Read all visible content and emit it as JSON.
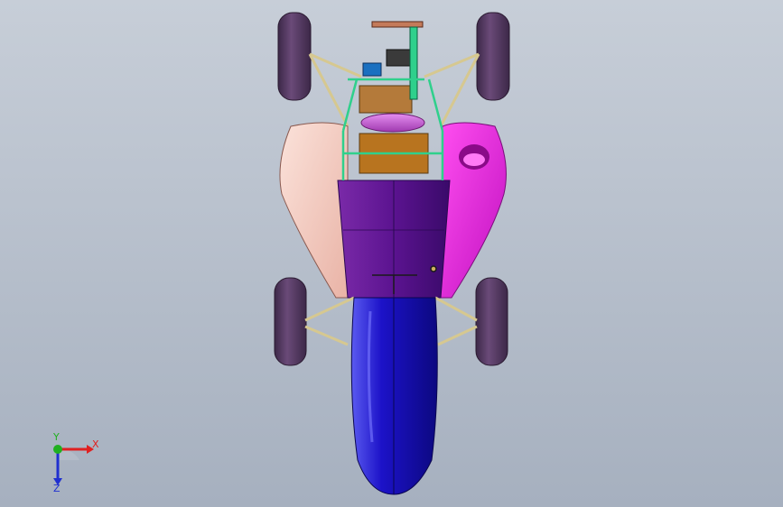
{
  "viewport": {
    "background_top": "#c7ced8",
    "background_bottom": "#a6b0bf"
  },
  "model": {
    "colors": {
      "tire": "#5a3f63",
      "nose": "#1c12c8",
      "pod_left": "#f6cfc4",
      "pod_right": "#e21ee0",
      "tub": "#5b1390",
      "frame_green": "#2fd08c",
      "engine": "#b47a3a",
      "tank": "#c45ad0",
      "seat_box": "#b8741f"
    }
  },
  "triad": {
    "x_label": "X",
    "y_label": "Y",
    "z_label": "Z",
    "x_color": "#e02020",
    "y_color": "#20b020",
    "z_color": "#2030d0"
  }
}
